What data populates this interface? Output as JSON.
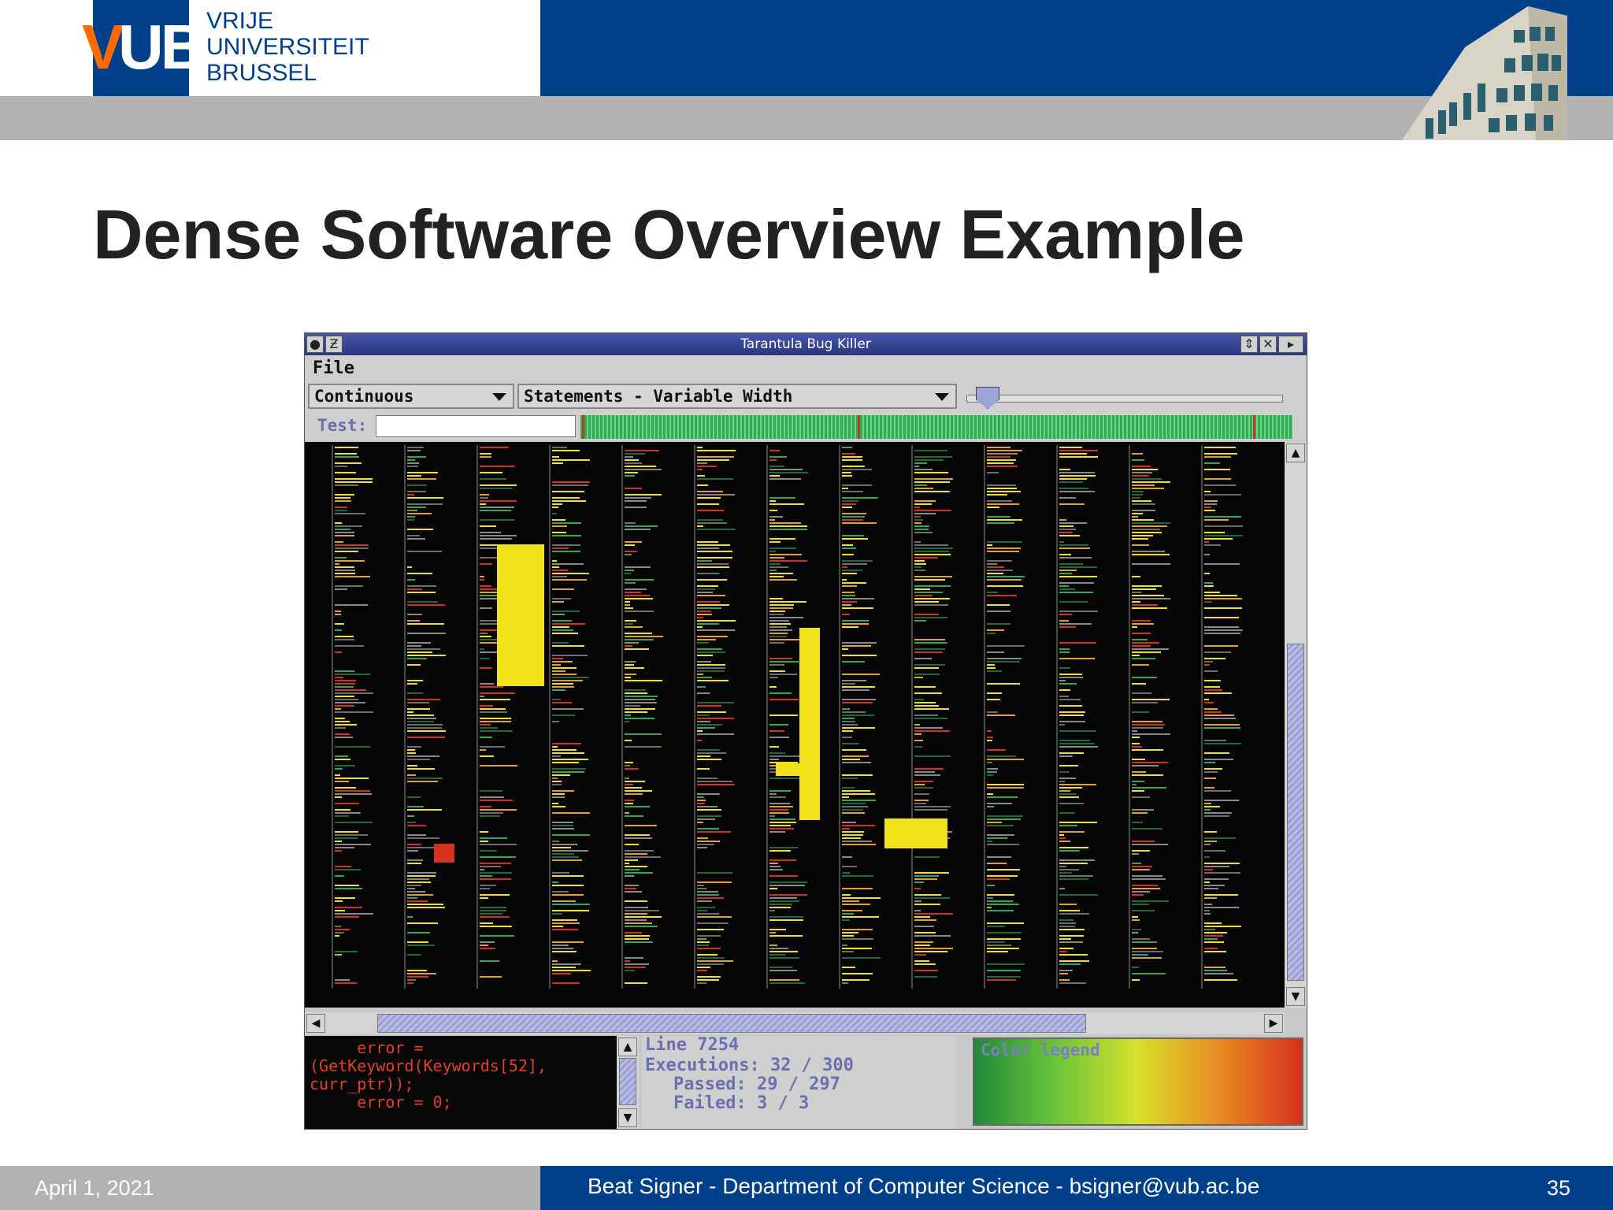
{
  "header": {
    "logo_letters_v": "V",
    "logo_letters_ub": "UB",
    "university_lines": [
      "VRIJE",
      "UNIVERSITEIT",
      "BRUSSEL"
    ]
  },
  "slide": {
    "title": "Dense Software Overview Example"
  },
  "app": {
    "window_title": "Tarantula Bug Killer",
    "menu": [
      "File"
    ],
    "mode_select": "Continuous",
    "view_select": "Statements - Variable Width",
    "test_label": "Test:",
    "test_value": "",
    "code_lines": [
      "     error =",
      "(GetKeyword(Keywords[52],",
      "curr_ptr));",
      "     error = 0;"
    ],
    "line_label": "Line 7254",
    "executions": "Executions: 32 / 300",
    "passed": "Passed: 29 / 297",
    "failed": "Failed: 3 / 3",
    "legend_label": "Color legend",
    "colors": {
      "pass": "#2faa55",
      "suspicious": "#f2e21a",
      "fail": "#d8301e",
      "panel": "#c8c8c8",
      "titlebar": "#2b3580"
    }
  },
  "footer": {
    "date": "April 1, 2021",
    "center": "Beat Signer - Department of Computer Science - bsigner@vub.ac.be",
    "page": "35"
  }
}
